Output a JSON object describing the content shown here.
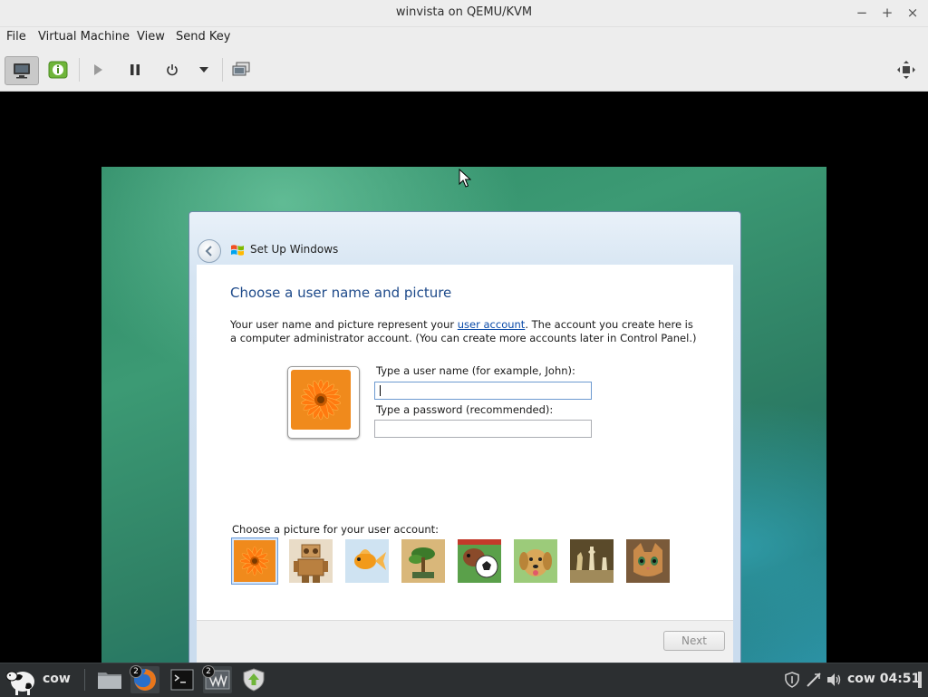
{
  "window": {
    "title": "winvista on QEMU/KVM",
    "controls": {
      "minimize": "−",
      "maximize": "+",
      "close": "×"
    }
  },
  "menu": {
    "items": [
      "File",
      "Virtual Machine",
      "View",
      "Send Key"
    ]
  },
  "toolbar": {
    "buttons": [
      "console-icon",
      "details-icon",
      "run-icon",
      "pause-icon",
      "power-icon",
      "power-dropdown-icon",
      "snapshots-icon",
      "fullscreen-icon"
    ]
  },
  "setup": {
    "window_title": "Set Up Windows",
    "heading": "Choose a user name and picture",
    "para_prefix": "Your user name and picture represent your ",
    "para_link": "user account",
    "para_suffix": ". The account you create here is a computer administrator account. (You can create more accounts later in Control Panel.)",
    "username_label": "Type a user name (for example, John):",
    "username_value": "",
    "password_label": "Type a password (recommended):",
    "password_value": "",
    "picture_label": "Choose a picture for your user account:",
    "pictures": [
      "flower",
      "robot",
      "fish",
      "bonsai",
      "soccer-ball",
      "dog",
      "chess",
      "kitten"
    ],
    "selected_picture": "flower",
    "next_label": "Next"
  },
  "taskbar": {
    "user_label": "cow",
    "apps": [
      {
        "name": "file-manager-icon",
        "badge": ""
      },
      {
        "name": "firefox-icon",
        "badge": "2"
      },
      {
        "name": "terminal-icon",
        "badge": ""
      },
      {
        "name": "virt-manager-icon",
        "badge": "2"
      },
      {
        "name": "update-manager-icon",
        "badge": ""
      }
    ],
    "clock": "cow 04:51"
  },
  "colors": {
    "accent": "#1e4a8a",
    "link": "#0a4aa8",
    "taskbar": "#2c2f31"
  }
}
